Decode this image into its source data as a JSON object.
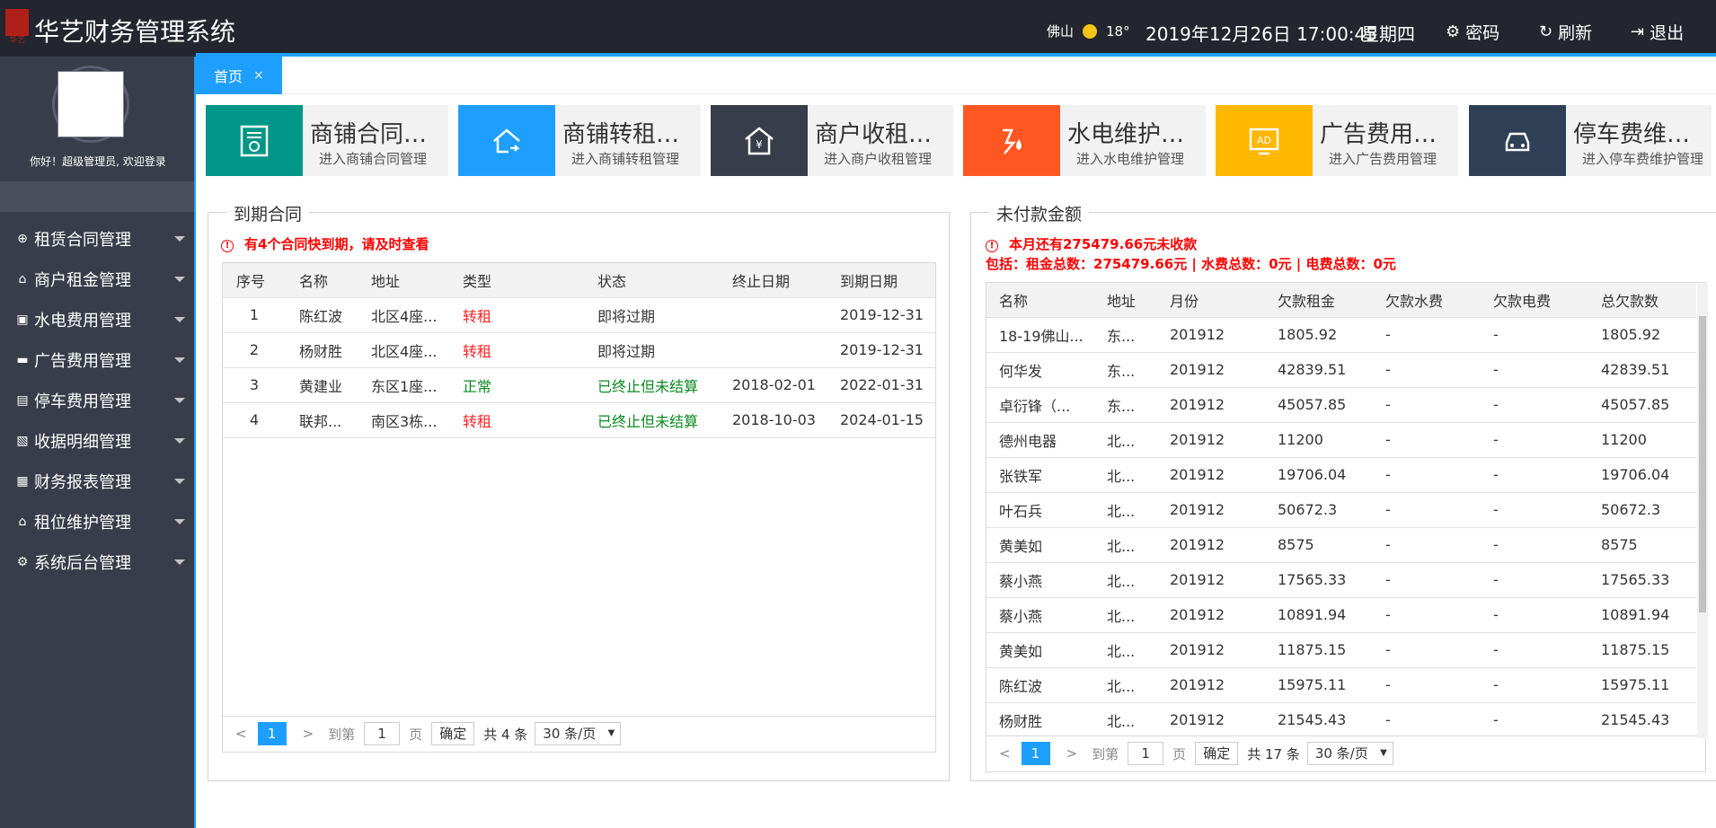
{
  "header": {
    "logo_text": "华艺",
    "title": "华艺财务管理系统",
    "city": "佛山",
    "temperature": "18°",
    "datetime": "2019年12月26日 17:00:45",
    "weekday": "星期四",
    "password_label": "密码",
    "refresh_label": "刷新",
    "logout_label": "退出"
  },
  "sidebar": {
    "welcome": "你好！超级管理员, 欢迎登录",
    "items": [
      {
        "label": "租赁合同管理",
        "icon": "contract-icon"
      },
      {
        "label": "商户租金管理",
        "icon": "home-icon"
      },
      {
        "label": "水电费用管理",
        "icon": "wallet-icon"
      },
      {
        "label": "广告费用管理",
        "icon": "monitor-icon"
      },
      {
        "label": "停车费用管理",
        "icon": "parking-icon"
      },
      {
        "label": "收据明细管理",
        "icon": "receipt-icon"
      },
      {
        "label": "财务报表管理",
        "icon": "report-icon"
      },
      {
        "label": "租位维护管理",
        "icon": "house-icon"
      },
      {
        "label": "系统后台管理",
        "icon": "gear-icon"
      }
    ]
  },
  "tabs": {
    "home": "首页",
    "close": "×"
  },
  "cards": [
    {
      "title": "商铺合同管理",
      "sub": "进入商铺合同管理",
      "color": "#009688",
      "icon": "certificate-icon"
    },
    {
      "title": "商铺转租管理",
      "sub": "进入商铺转租管理",
      "color": "#1e9fff",
      "icon": "house-share-icon"
    },
    {
      "title": "商户收租管理",
      "sub": "进入商户收租管理",
      "color": "#393d49",
      "icon": "house-yen-icon"
    },
    {
      "title": "水电维护管理",
      "sub": "进入水电维护管理",
      "color": "#ff5722",
      "icon": "water-bolt-icon"
    },
    {
      "title": "广告费用管理",
      "sub": "进入广告费用管理",
      "color": "#ffb800",
      "icon": "ad-screen-icon"
    },
    {
      "title": "停车费维护管理",
      "sub": "进入停车费维护管理",
      "color": "#2f4056",
      "icon": "car-icon"
    }
  ],
  "expiring": {
    "legend": "到期合同",
    "alert": "有4个合同快到期，请及时查看",
    "columns": [
      "序号",
      "名称",
      "地址",
      "类型",
      "状态",
      "终止日期",
      "到期日期"
    ],
    "rows": [
      [
        "1",
        "陈红波",
        "北区4座...",
        "转租",
        "即将过期",
        "",
        "2019-12-31"
      ],
      [
        "2",
        "杨财胜",
        "北区4座...",
        "转租",
        "即将过期",
        "",
        "2019-12-31"
      ],
      [
        "3",
        "黄建业",
        "东区1座...",
        "正常",
        "已终止但未结算",
        "2018-02-01",
        "2022-01-31"
      ],
      [
        "4",
        "联邦...",
        "南区3栋...",
        "转租",
        "已终止但未结算",
        "2018-10-03",
        "2024-01-15"
      ]
    ],
    "pager": {
      "prev": "<",
      "page": "1",
      "next": ">",
      "goto": "到第",
      "input": "1",
      "page_unit": "页",
      "ok": "确定",
      "total": "共 4 条",
      "size": "30 条/页"
    }
  },
  "unpaid": {
    "legend": "未付款金额",
    "alert": "本月还有275479.66元未收款",
    "detail": "包括：租金总数：275479.66元 | 水费总数：0元 | 电费总数：0元",
    "columns": [
      "名称",
      "地址",
      "月份",
      "欠款租金",
      "欠款水费",
      "欠款电费",
      "总欠款数"
    ],
    "rows": [
      [
        "18-19佛山...",
        "东...",
        "201912",
        "1805.92",
        "-",
        "-",
        "1805.92"
      ],
      [
        "何华发",
        "东...",
        "201912",
        "42839.51",
        "-",
        "-",
        "42839.51"
      ],
      [
        "卓衍锋（...",
        "东...",
        "201912",
        "45057.85",
        "-",
        "-",
        "45057.85"
      ],
      [
        "德州电器",
        "北...",
        "201912",
        "11200",
        "-",
        "-",
        "11200"
      ],
      [
        "张铁军",
        "北...",
        "201912",
        "19706.04",
        "-",
        "-",
        "19706.04"
      ],
      [
        "叶石兵",
        "北...",
        "201912",
        "50672.3",
        "-",
        "-",
        "50672.3"
      ],
      [
        "黄美如",
        "北...",
        "201912",
        "8575",
        "-",
        "-",
        "8575"
      ],
      [
        "蔡小燕",
        "北...",
        "201912",
        "17565.33",
        "-",
        "-",
        "17565.33"
      ],
      [
        "蔡小燕",
        "北...",
        "201912",
        "10891.94",
        "-",
        "-",
        "10891.94"
      ],
      [
        "黄美如",
        "北...",
        "201912",
        "11875.15",
        "-",
        "-",
        "11875.15"
      ],
      [
        "陈红波",
        "北...",
        "201912",
        "15975.11",
        "-",
        "-",
        "15975.11"
      ],
      [
        "杨财胜",
        "北...",
        "201912",
        "21545.43",
        "-",
        "-",
        "21545.43"
      ]
    ],
    "pager": {
      "prev": "<",
      "page": "1",
      "next": ">",
      "goto": "到第",
      "input": "1",
      "page_unit": "页",
      "ok": "确定",
      "total": "共 17 条",
      "size": "30 条/页"
    }
  }
}
